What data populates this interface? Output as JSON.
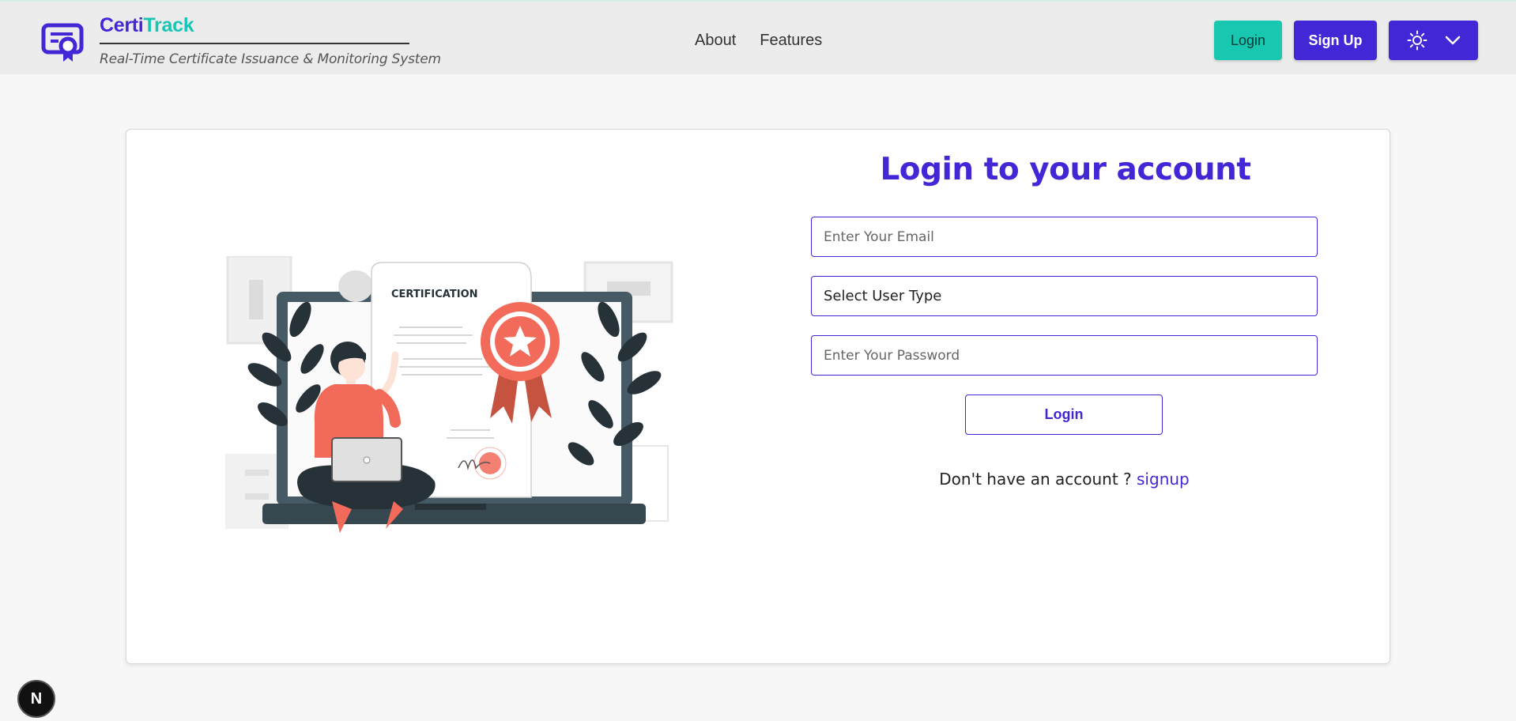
{
  "header": {
    "brand_part1": "Certi",
    "brand_part2": "Track",
    "tagline": "Real-Time Certificate Issuance & Monitoring System",
    "nav": [
      "About",
      "Features"
    ],
    "login_label": "Login",
    "signup_label": "Sign Up",
    "theme_icon": "sun-icon",
    "theme_dropdown_icon": "chevron-down-icon"
  },
  "login_form": {
    "title": "Login to your account",
    "email_placeholder": "Enter Your Email",
    "user_type_label": "Select User Type",
    "password_placeholder": "Enter Your Password",
    "submit_label": "Login",
    "no_account_text": "Don't have an account ?",
    "signup_link": "signup"
  },
  "illustration": {
    "certificate_heading": "CERTIFICATION"
  },
  "dev_badge": "N",
  "colors": {
    "primary": "#4127d6",
    "accent": "#17c6b4",
    "illustration_accent": "#f26a5a"
  }
}
